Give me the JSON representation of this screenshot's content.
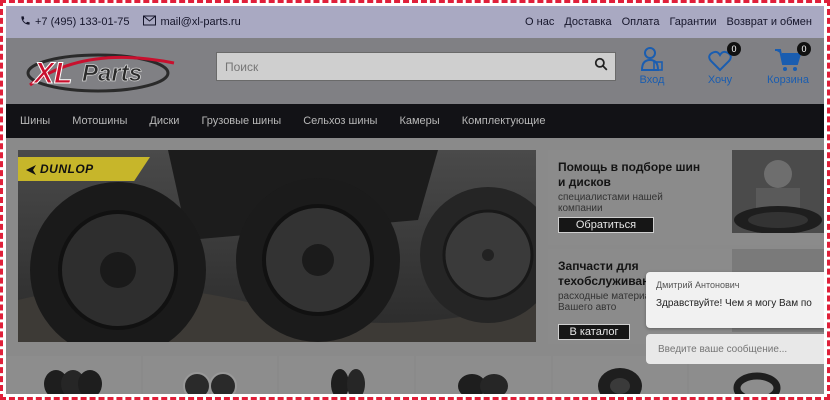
{
  "topbar": {
    "phone": "+7 (495) 133-01-75",
    "email": "mail@xl-parts.ru",
    "links": [
      "О нас",
      "Доставка",
      "Оплата",
      "Гарантии",
      "Возврат и обмен"
    ]
  },
  "header": {
    "logo_text": "XLParts",
    "search_placeholder": "Поиск",
    "icons": [
      {
        "label": "Вход",
        "icon": "user-icon",
        "badge": null
      },
      {
        "label": "Хочу",
        "icon": "heart-icon",
        "badge": "0"
      },
      {
        "label": "Корзина",
        "icon": "cart-icon",
        "badge": "0"
      }
    ]
  },
  "nav": {
    "items": [
      "Шины",
      "Мотошины",
      "Диски",
      "Грузовые шины",
      "Сельхоз шины",
      "Камеры",
      "Комплектующие"
    ]
  },
  "banner": {
    "brand": "DUNLOP"
  },
  "promo1": {
    "title": "Помощь в подборе шин и дисков",
    "subtitle": "специалистами нашей компании",
    "button": "Обратиться"
  },
  "promo2": {
    "title": "Запчасти для техобслуживания",
    "subtitle": "расходные материалы для Вашего авто",
    "button": "В каталог"
  },
  "chat": {
    "agent_name": "Дмитрий Антонович",
    "message": "Здравствуйте! Чем я могу Вам по",
    "input_placeholder": "Введите ваше сообщение..."
  },
  "colors": {
    "accent_blue": "#1a5db0",
    "logo_red": "#c8102e",
    "dunlop_yellow": "#c7b62a",
    "frame_red": "#e0203a"
  }
}
